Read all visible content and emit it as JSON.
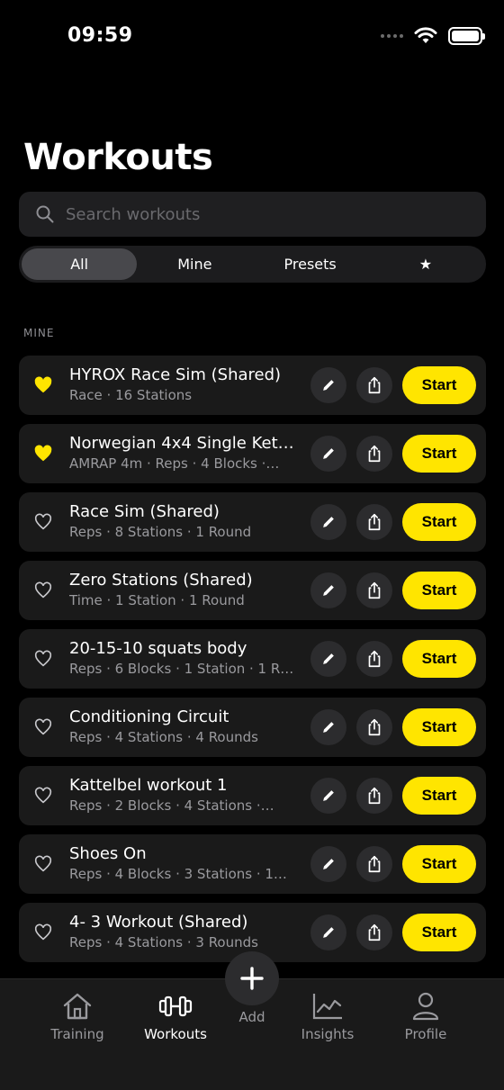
{
  "status": {
    "time": "09:59"
  },
  "title": "Workouts",
  "search": {
    "placeholder": "Search workouts"
  },
  "segments": [
    "All",
    "Mine",
    "Presets",
    "★"
  ],
  "section": "MINE",
  "workouts": [
    {
      "title": "HYROX Race Sim (Shared)",
      "subtitle": "Race · 16 Stations",
      "favorite": true
    },
    {
      "title": "Norwegian 4x4 Single Ket…",
      "subtitle": "AMRAP 4m · Reps · 4 Blocks ·…",
      "favorite": true
    },
    {
      "title": "Race Sim (Shared)",
      "subtitle": "Reps · 8 Stations · 1 Round",
      "favorite": false
    },
    {
      "title": "Zero Stations (Shared)",
      "subtitle": "Time · 1 Station · 1 Round",
      "favorite": false
    },
    {
      "title": "20-15-10  squats body",
      "subtitle": "Reps · 6 Blocks · 1 Station · 1 R…",
      "favorite": false
    },
    {
      "title": "Conditioning Circuit",
      "subtitle": "Reps · 4 Stations · 4 Rounds",
      "favorite": false
    },
    {
      "title": "Kattelbel workout 1",
      "subtitle": "Reps · 2 Blocks · 4 Stations ·…",
      "favorite": false
    },
    {
      "title": "Shoes On",
      "subtitle": "Reps · 4 Blocks · 3 Stations · 1…",
      "favorite": false
    },
    {
      "title": "4- 3 Workout (Shared)",
      "subtitle": "Reps · 4 Stations · 3 Rounds",
      "favorite": false
    }
  ],
  "start_label": "Start",
  "tabs": {
    "training": "Training",
    "workouts": "Workouts",
    "add": "Add",
    "insights": "Insights",
    "profile": "Profile"
  },
  "colors": {
    "accent": "#ffe500",
    "background": "#000000",
    "card": "#1a1a1a"
  }
}
